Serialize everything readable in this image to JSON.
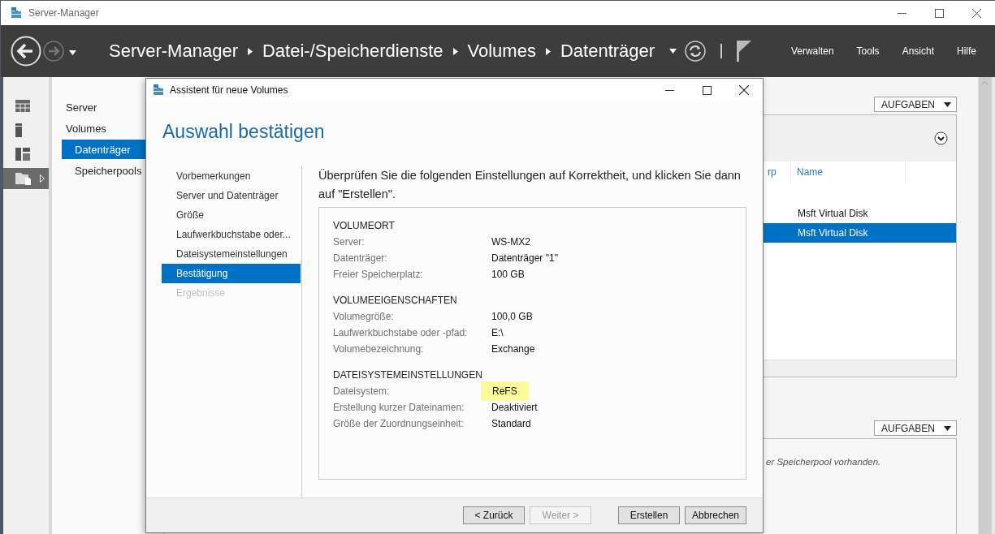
{
  "window": {
    "title": "Server-Manager"
  },
  "header": {
    "breadcrumb": [
      "Server-Manager",
      "Datei-/Speicherdienste",
      "Volumes",
      "Datenträger"
    ],
    "menu": [
      "Verwalten",
      "Tools",
      "Ansicht",
      "Hilfe"
    ]
  },
  "rail": [
    {
      "kind": "dashboard",
      "selected": false
    },
    {
      "kind": "server",
      "selected": false
    },
    {
      "kind": "roles",
      "selected": false
    },
    {
      "kind": "storage",
      "selected": true
    }
  ],
  "nav": [
    {
      "label": "Server",
      "selected": false
    },
    {
      "label": "Volumes",
      "selected": false,
      "children": [
        {
          "label": "Datenträger",
          "selected": true
        },
        {
          "label": "Speicherpools",
          "selected": false
        }
      ]
    }
  ],
  "disks_panel": {
    "tasks_button": "AUFGABEN",
    "columns": [
      "rp",
      "Name"
    ],
    "rows": [
      {
        "name": "Msft Virtual Disk",
        "selected": false
      },
      {
        "name": "Msft Virtual Disk",
        "selected": true
      }
    ]
  },
  "pools_panel": {
    "tasks_button": "AUFGABEN",
    "message": "er Speicherpool vorhanden."
  },
  "dialog": {
    "title": "Assistent für neue Volumes",
    "heading": "Auswahl bestätigen",
    "steps": [
      {
        "label": "Vorbemerkungen",
        "selected": false,
        "disabled": false
      },
      {
        "label": "Server und Datenträger",
        "selected": false,
        "disabled": false
      },
      {
        "label": "Größe",
        "selected": false,
        "disabled": false
      },
      {
        "label": "Laufwerkbuchstabe oder...",
        "selected": false,
        "disabled": false
      },
      {
        "label": "Dateisystemeinstellungen",
        "selected": false,
        "disabled": false
      },
      {
        "label": "Bestätigung",
        "selected": true,
        "disabled": false
      },
      {
        "label": "Ergebnisse",
        "selected": false,
        "disabled": true
      }
    ],
    "instruction": "Überprüfen Sie die folgenden Einstellungen auf Korrektheit, und klicken Sie dann auf \"Erstellen\".",
    "sections": [
      {
        "heading": "VOLUMEORT",
        "rows": [
          {
            "label": "Server:",
            "value": "WS-MX2",
            "highlighted": false
          },
          {
            "label": "Datenträger:",
            "value": "Datenträger \"1\"",
            "highlighted": false
          },
          {
            "label": "Freier Speicherplatz:",
            "value": "100 GB",
            "highlighted": false
          }
        ]
      },
      {
        "heading": "VOLUMEEIGENSCHAFTEN",
        "rows": [
          {
            "label": "Volumegröße:",
            "value": "100,0 GB",
            "highlighted": false
          },
          {
            "label": "Laufwerkbuchstabe oder -pfad:",
            "value": "E:\\",
            "highlighted": false
          },
          {
            "label": "Volumebezeichnung:",
            "value": "Exchange",
            "highlighted": false
          }
        ]
      },
      {
        "heading": "DATEISYSTEMEINSTELLUNGEN",
        "rows": [
          {
            "label": "Dateisystem:",
            "value": "ReFS",
            "highlighted": true
          },
          {
            "label": "Erstellung kurzer Dateinamen:",
            "value": "Deaktiviert",
            "highlighted": false
          },
          {
            "label": "Größe der Zuordnungseinheit:",
            "value": "Standard",
            "highlighted": false
          }
        ]
      }
    ],
    "buttons": [
      {
        "label": "< Zurück",
        "disabled": false
      },
      {
        "label": "Weiter >",
        "disabled": true
      },
      {
        "label": "Erstellen",
        "disabled": false
      },
      {
        "label": "Abbrechen",
        "disabled": false
      }
    ]
  }
}
